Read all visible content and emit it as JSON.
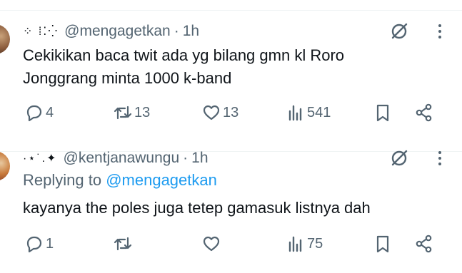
{
  "tweets": [
    {
      "display_name": "⁘ ⁞⁚⁛",
      "handle": "@mengagetkan",
      "separator": "·",
      "time": "1h",
      "text_lines": [
        "Cekikikan baca twit ada yg bilang gmn kl Roro",
        "Jonggrang minta 1000 k-band"
      ],
      "reply_count": "4",
      "retweet_count": "13",
      "like_count": "13",
      "view_count": "541"
    },
    {
      "display_name": "·⋆˙.✦",
      "handle": "@kentjanawungu",
      "separator": "·",
      "time": "1h",
      "replying_label": "Replying to",
      "replying_to": "@mengagetkan",
      "text_lines": [
        "kayanya the poles juga tetep gamasuk listnya dah"
      ],
      "reply_count": "1",
      "retweet_count": "",
      "like_count": "",
      "view_count": "75"
    }
  ],
  "colors": {
    "text": "#0f1419",
    "secondary": "#536471",
    "link": "#1d9bf0"
  },
  "icons": [
    "grok-icon",
    "more-icon",
    "reply-icon",
    "retweet-icon",
    "like-icon",
    "views-icon",
    "bookmark-icon",
    "share-icon"
  ]
}
